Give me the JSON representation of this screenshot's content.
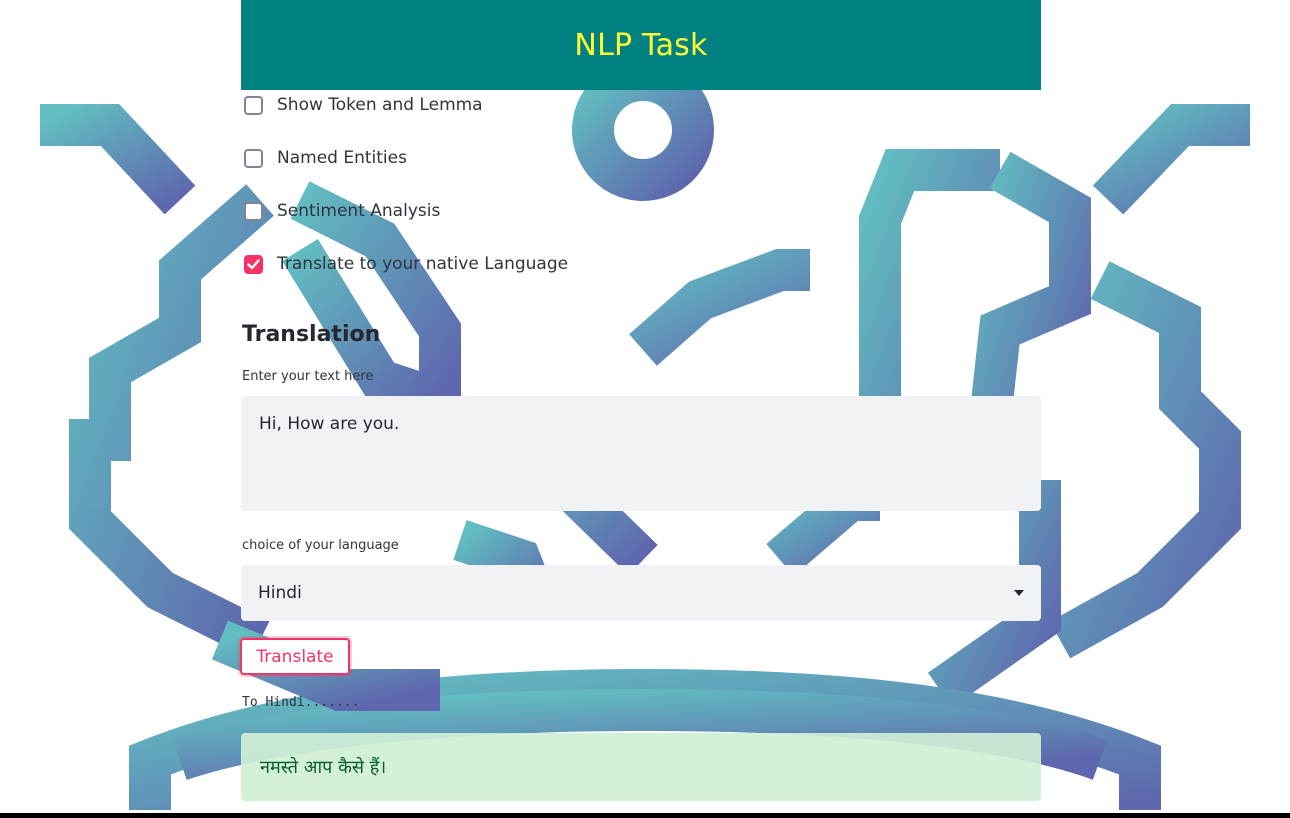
{
  "header": {
    "title": "NLP Task"
  },
  "options": [
    {
      "label": "Show Token and Lemma",
      "checked": false
    },
    {
      "label": "Named Entities",
      "checked": false
    },
    {
      "label": "Sentiment Analysis",
      "checked": false
    },
    {
      "label": "Translate to your native Language",
      "checked": true
    }
  ],
  "translation": {
    "title": "Translation",
    "input_label": "Enter your text here",
    "input_value": "Hi, How are you.",
    "language_label": "choice of your language",
    "language_selected": "Hindi",
    "button_label": "Translate",
    "status_text": "To Hindi.......",
    "result_text": "नमस्ते आप कैसे हैं।"
  },
  "colors": {
    "header_bg": "#008080",
    "header_text": "#ffff33",
    "accent": "#f63366",
    "input_bg": "#f0f2f6",
    "success_bg": "#cfefd6"
  },
  "icons": [
    "checkbox-icon",
    "check-icon",
    "chevron-down-icon",
    "nlp-brain-circuit-logo"
  ]
}
